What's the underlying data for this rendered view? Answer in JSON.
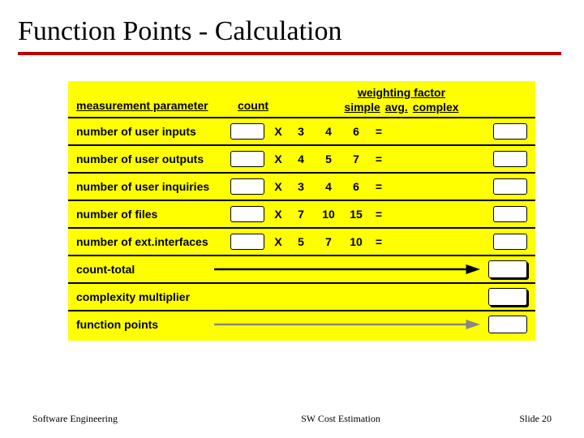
{
  "title": "Function Points - Calculation",
  "headers": {
    "parameter": "measurement parameter",
    "count": "count",
    "weighting_factor": "weighting factor",
    "simple": "simple",
    "avg": "avg.",
    "complex": "complex"
  },
  "rows": [
    {
      "label": "number of user inputs",
      "x": "X",
      "simple": "3",
      "avg": "4",
      "complex": "6",
      "eq": "="
    },
    {
      "label": "number of user outputs",
      "x": "X",
      "simple": "4",
      "avg": "5",
      "complex": "7",
      "eq": "="
    },
    {
      "label": "number of user inquiries",
      "x": "X",
      "simple": "3",
      "avg": "4",
      "complex": "6",
      "eq": "="
    },
    {
      "label": "number of files",
      "x": "X",
      "simple": "7",
      "avg": "10",
      "complex": "15",
      "eq": "="
    },
    {
      "label": "number of ext.interfaces",
      "x": "X",
      "simple": "5",
      "avg": "7",
      "complex": "10",
      "eq": "="
    }
  ],
  "summary": {
    "count_total": "count-total",
    "complexity_multiplier": "complexity multiplier",
    "function_points": "function points"
  },
  "footer": {
    "left": "Software Engineering",
    "center": "SW Cost Estimation",
    "right": "Slide 20"
  }
}
